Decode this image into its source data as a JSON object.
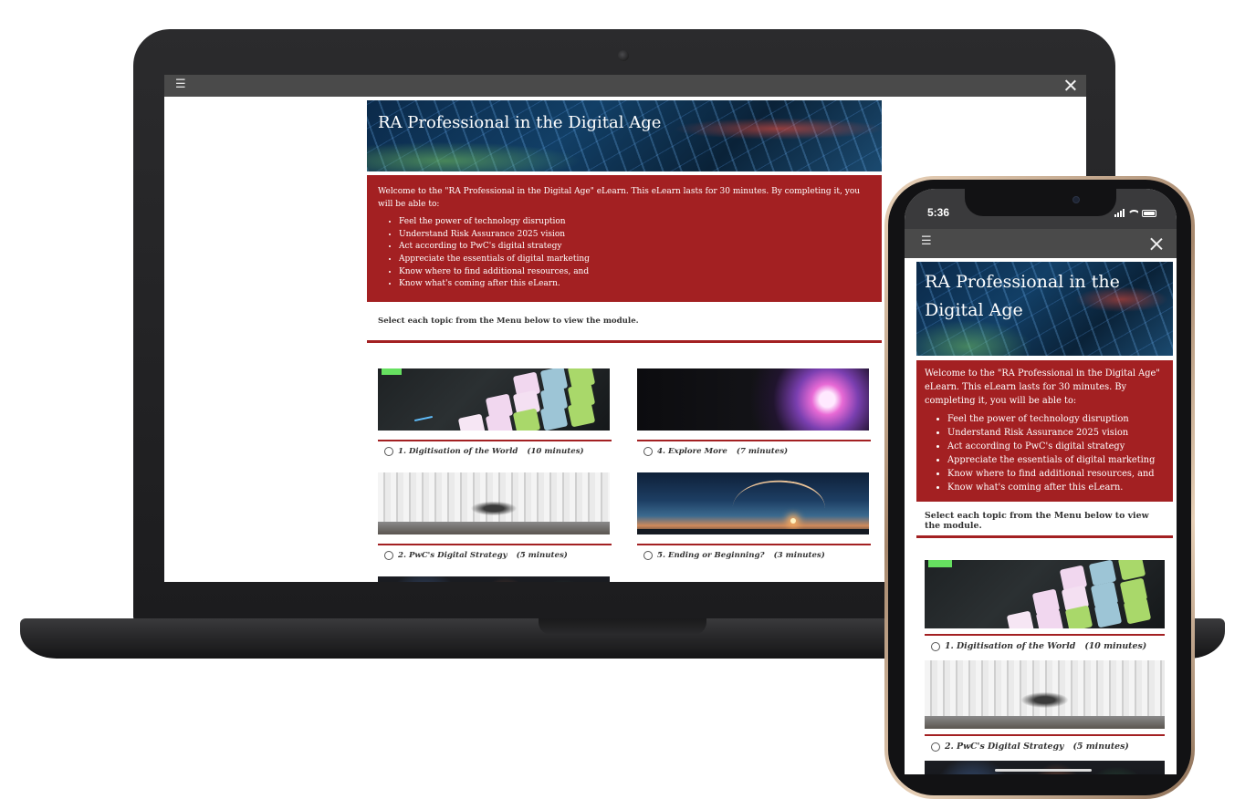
{
  "course": {
    "title": "RA Professional in the Digital Age",
    "intro": "Welcome to the \"RA Professional in the Digital Age\" eLearn. This eLearn lasts for 30 minutes. By completing it, you will be able to:",
    "objectives": [
      "Feel the power of technology disruption",
      "Understand Risk Assurance 2025 vision",
      "Act according to PwC's digital strategy",
      "Appreciate the essentials of digital marketing",
      "Know where to find additional resources, and",
      "Know what's coming after this eLearn."
    ],
    "select_instruction": "Select each topic from the Menu below to view the module."
  },
  "toolbar": {
    "menu_icon": "hamburger-menu-icon",
    "menu_glyph": "☰",
    "close_icon": "close-icon"
  },
  "modules": [
    {
      "title": "1. Digitisation of the World",
      "duration": "(10 minutes)",
      "image": "launchpad-controller"
    },
    {
      "title": "2. PwC's Digital Strategy",
      "duration": "(5 minutes)",
      "image": "oculus-architecture"
    },
    {
      "title": "4. Explore More",
      "duration": "(7 minutes)",
      "image": "plasma-ball"
    },
    {
      "title": "5. Ending or Beginning?",
      "duration": "(3 minutes)",
      "image": "rocket-launch"
    }
  ],
  "phone": {
    "status_time": "5:36"
  },
  "colors": {
    "accent_red": "#a32022",
    "toolbar_gray": "#4a4a4a"
  }
}
